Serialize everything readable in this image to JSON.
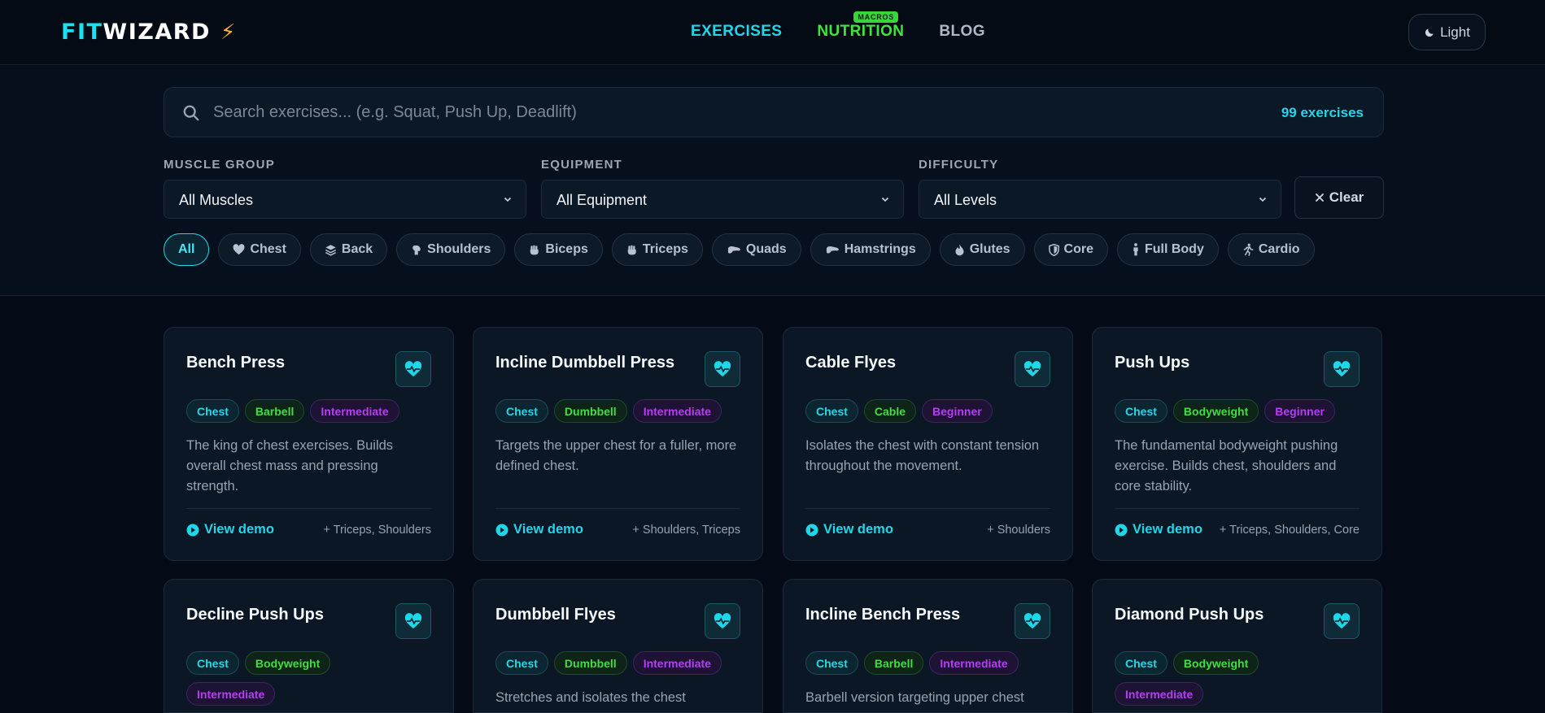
{
  "header": {
    "logo_fit": "FIT",
    "logo_wizard": "WIZARD",
    "logo_bolt": "⚡",
    "nav": [
      {
        "label": "EXERCISES"
      },
      {
        "label": "NUTRITION",
        "badge": "MACROS"
      },
      {
        "label": "BLOG"
      }
    ],
    "theme_toggle": "Light"
  },
  "search": {
    "placeholder": "Search exercises... (e.g. Squat, Push Up, Deadlift)",
    "count": "99 exercises"
  },
  "filters": {
    "muscle_label": "MUSCLE GROUP",
    "muscle_value": "All Muscles",
    "equipment_label": "EQUIPMENT",
    "equipment_value": "All Equipment",
    "difficulty_label": "DIFFICULTY",
    "difficulty_value": "All Levels",
    "clear": "Clear"
  },
  "chips": [
    {
      "label": "All",
      "active": true,
      "icon": ""
    },
    {
      "label": "Chest",
      "icon": "heart-icon"
    },
    {
      "label": "Back",
      "icon": "layers-icon"
    },
    {
      "label": "Shoulders",
      "icon": "shoulder-icon"
    },
    {
      "label": "Biceps",
      "icon": "fist-icon"
    },
    {
      "label": "Triceps",
      "icon": "fist-icon"
    },
    {
      "label": "Quads",
      "icon": "leg-icon"
    },
    {
      "label": "Hamstrings",
      "icon": "leg-icon"
    },
    {
      "label": "Glutes",
      "icon": "flame-icon"
    },
    {
      "label": "Core",
      "icon": "shield-icon"
    },
    {
      "label": "Full Body",
      "icon": "person-icon"
    },
    {
      "label": "Cardio",
      "icon": "runner-icon"
    }
  ],
  "cards": [
    {
      "title": "Bench Press",
      "muscle": "Chest",
      "equipment": "Barbell",
      "difficulty": "Intermediate",
      "desc": "The king of chest exercises. Builds overall chest mass and pressing strength.",
      "demo": "View demo",
      "secondary": "+ Triceps, Shoulders"
    },
    {
      "title": "Incline Dumbbell Press",
      "muscle": "Chest",
      "equipment": "Dumbbell",
      "difficulty": "Intermediate",
      "desc": "Targets the upper chest for a fuller, more defined chest.",
      "demo": "View demo",
      "secondary": "+ Shoulders, Triceps"
    },
    {
      "title": "Cable Flyes",
      "muscle": "Chest",
      "equipment": "Cable",
      "difficulty": "Beginner",
      "desc": "Isolates the chest with constant tension throughout the movement.",
      "demo": "View demo",
      "secondary": "+ Shoulders"
    },
    {
      "title": "Push Ups",
      "muscle": "Chest",
      "equipment": "Bodyweight",
      "difficulty": "Beginner",
      "desc": "The fundamental bodyweight pushing exercise. Builds chest, shoulders and core stability.",
      "demo": "View demo",
      "secondary": "+ Triceps, Shoulders, Core"
    },
    {
      "title": "Decline Push Ups",
      "muscle": "Chest",
      "equipment": "Bodyweight",
      "difficulty": "Intermediate",
      "desc": "",
      "demo": "",
      "secondary": ""
    },
    {
      "title": "Dumbbell Flyes",
      "muscle": "Chest",
      "equipment": "Dumbbell",
      "difficulty": "Intermediate",
      "desc": "Stretches and isolates the chest",
      "demo": "",
      "secondary": ""
    },
    {
      "title": "Incline Bench Press",
      "muscle": "Chest",
      "equipment": "Barbell",
      "difficulty": "Intermediate",
      "desc": "Barbell version targeting upper chest",
      "demo": "",
      "secondary": ""
    },
    {
      "title": "Diamond Push Ups",
      "muscle": "Chest",
      "equipment": "Bodyweight",
      "difficulty": "Intermediate",
      "desc": "",
      "demo": "",
      "secondary": ""
    }
  ],
  "colors": {
    "accent": "#1ed8ea",
    "nutrition": "#3ee53c",
    "difficulty": "#b33ff0",
    "background": "#040b16"
  }
}
